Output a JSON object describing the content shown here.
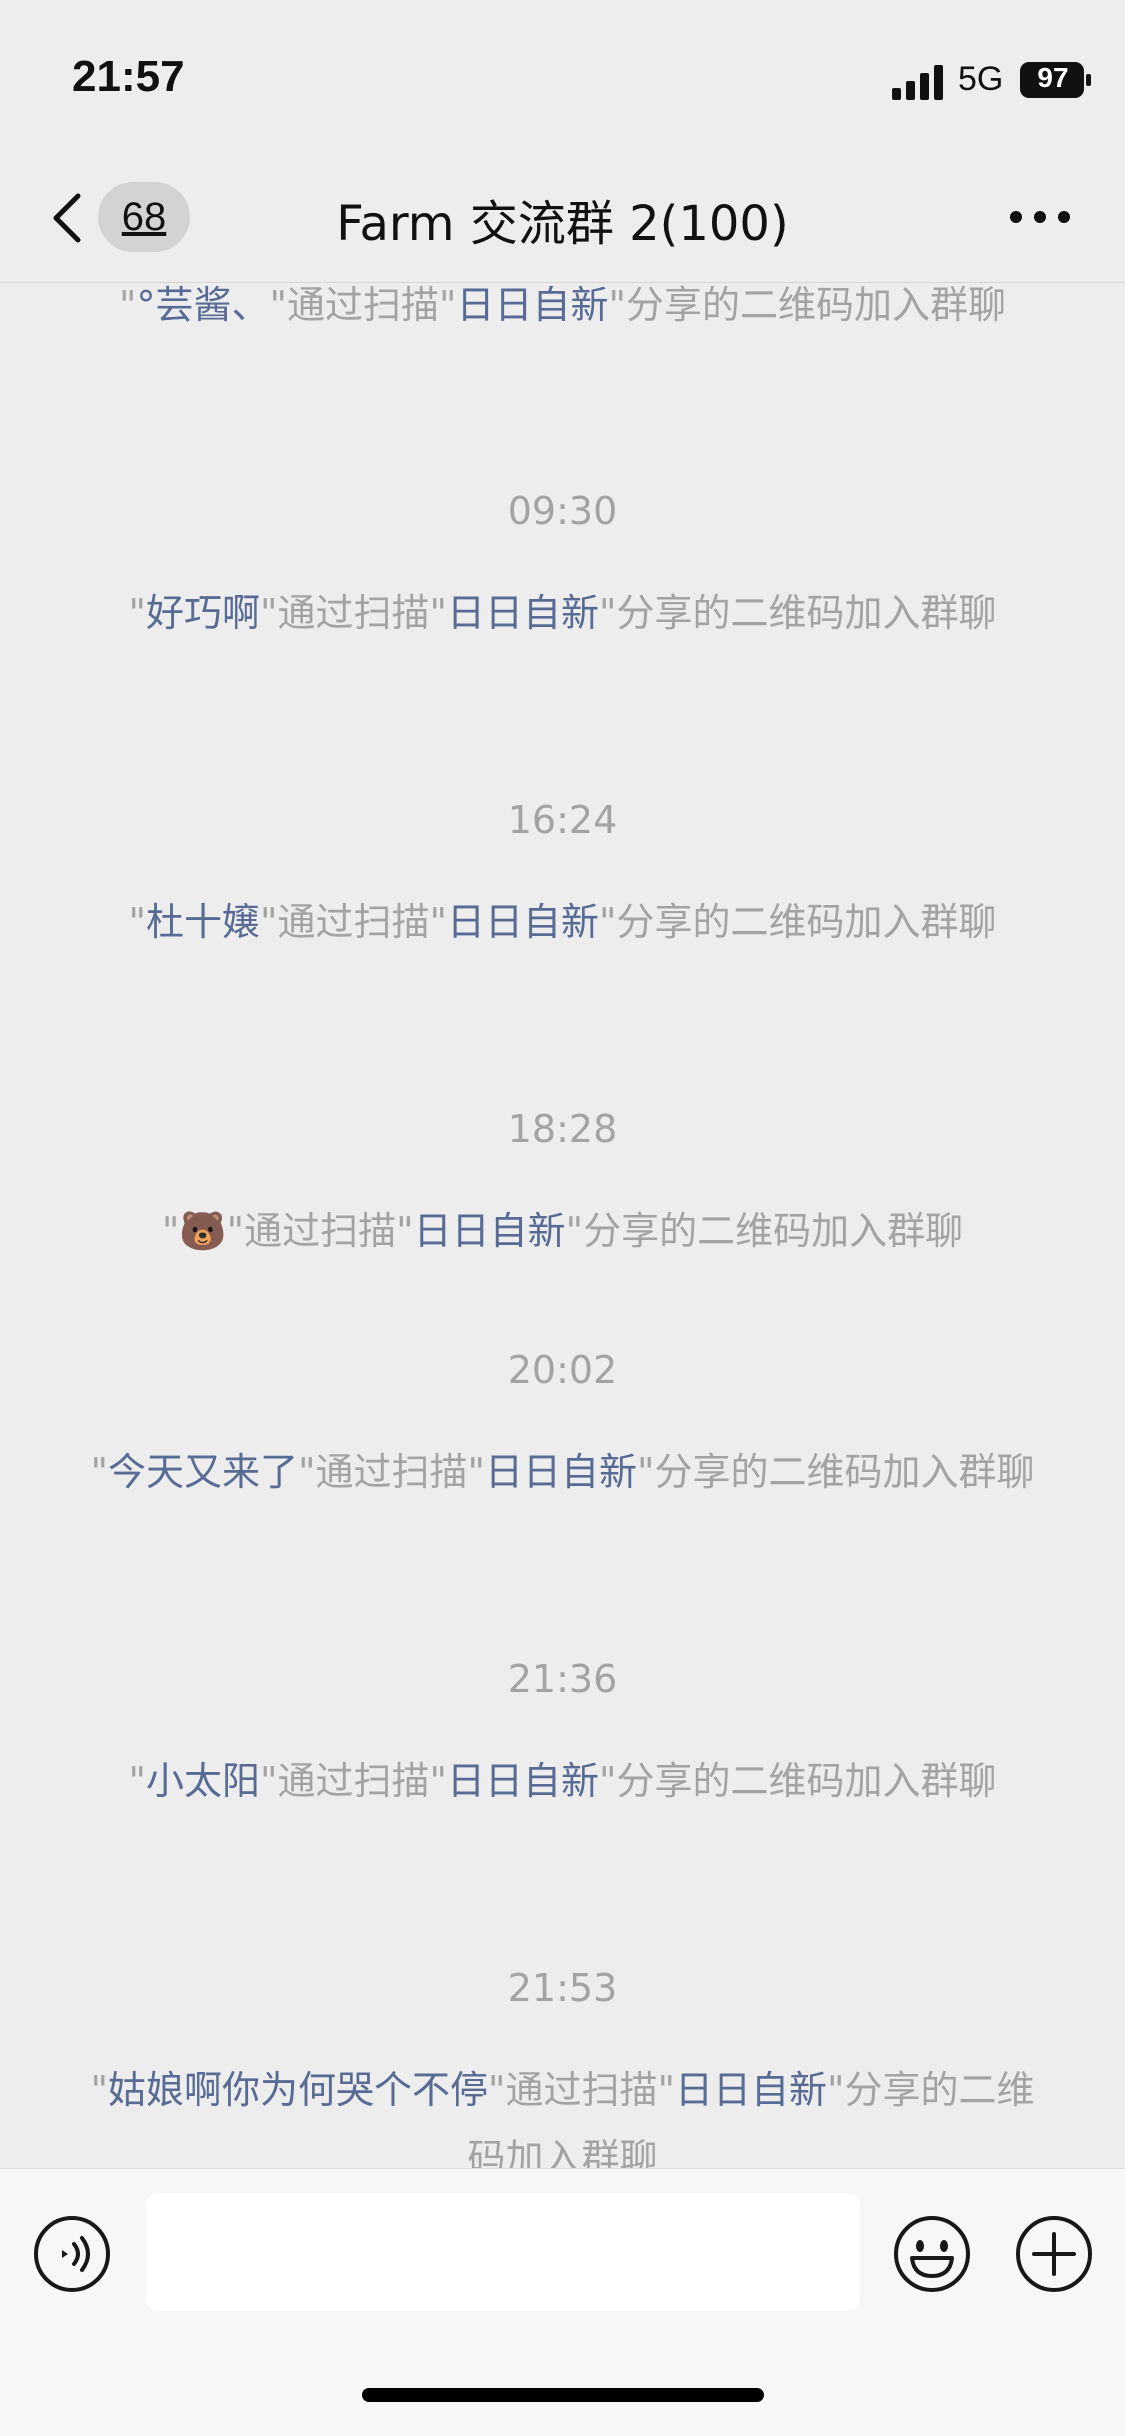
{
  "status_bar": {
    "time": "21:57",
    "network": "5G",
    "battery": "97",
    "signal_icon": "signal-bars-icon",
    "battery_icon": "battery-icon"
  },
  "nav": {
    "back_icon": "chevron-left-icon",
    "unread_count": "68",
    "title": "Farm 交流群 2(100)",
    "more_icon": "ellipsis-icon"
  },
  "messages": [
    {
      "type": "system",
      "open_quote": "\"",
      "name": "°芸酱、",
      "mid": "\"通过扫描\"",
      "inviter": "日日自新",
      "tail": "\"分享的二维码加入群聊"
    },
    {
      "type": "time",
      "text": "09:30"
    },
    {
      "type": "system",
      "open_quote": "\"",
      "name": "好巧啊",
      "mid": "\"通过扫描\"",
      "inviter": "日日自新",
      "tail": "\"分享的二维码加入群聊"
    },
    {
      "type": "time",
      "text": "16:24"
    },
    {
      "type": "system",
      "open_quote": "\"",
      "name": "杜十嬢",
      "mid": "\"通过扫描\"",
      "inviter": "日日自新",
      "tail": "\"分享的二维码加入群聊"
    },
    {
      "type": "time",
      "text": "18:28"
    },
    {
      "type": "system",
      "open_quote": "\"",
      "name": "🐻",
      "mid": "\"通过扫描\"",
      "inviter": "日日自新",
      "tail": "\"分享的二维码加入群聊"
    },
    {
      "type": "time",
      "text": "20:02"
    },
    {
      "type": "system",
      "open_quote": "\"",
      "name": "今天又来了",
      "mid": "\"通过扫描\"",
      "inviter": "日日自新",
      "tail": "\"分享的二维码加入群聊"
    },
    {
      "type": "time",
      "text": "21:36"
    },
    {
      "type": "system",
      "open_quote": "\"",
      "name": "小太阳",
      "mid": "\"通过扫描\"",
      "inviter": "日日自新",
      "tail": "\"分享的二维码加入群聊"
    },
    {
      "type": "time",
      "text": "21:53"
    },
    {
      "type": "system",
      "open_quote": "\"",
      "name": "姑娘啊你为何哭个不停",
      "mid": "\"通过扫描\"",
      "inviter": "日日自新",
      "tail": "\"分享的二维码加入群聊"
    }
  ],
  "input_bar": {
    "voice_icon": "voice-input-icon",
    "input_value": "",
    "emoji_icon": "emoji-icon",
    "plus_icon": "plus-circle-icon"
  },
  "colors": {
    "background": "#ededed",
    "system_text": "#a3a3a3",
    "name_link": "#576b95",
    "input_bar_bg": "#f7f7f7"
  }
}
